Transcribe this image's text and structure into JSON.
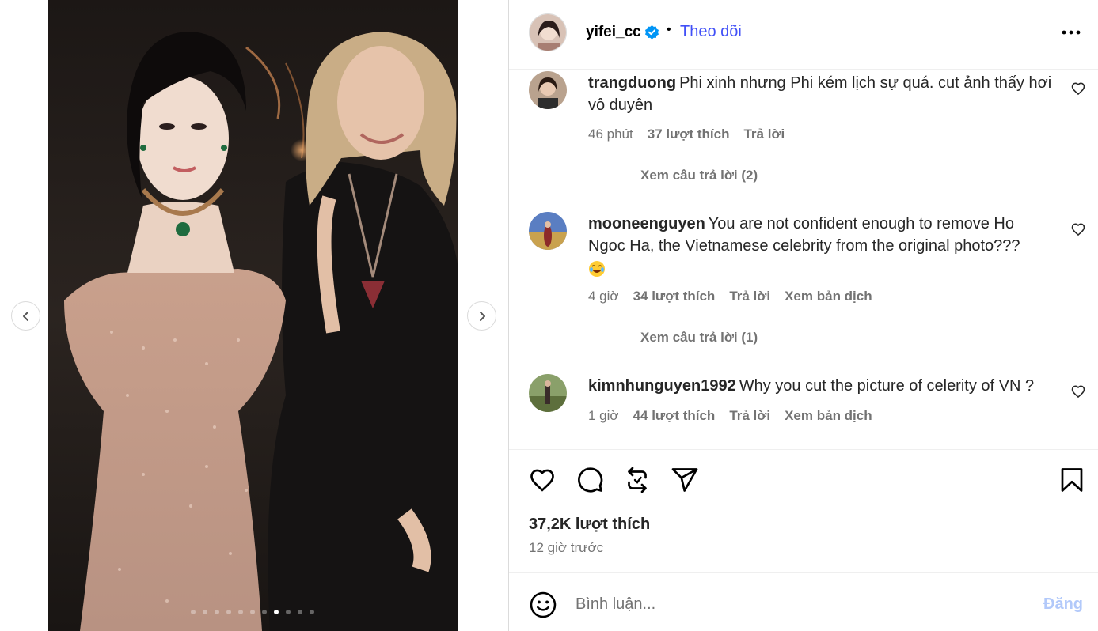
{
  "post": {
    "username": "yifei_cc",
    "separator": "•",
    "follow_label": "Theo dõi",
    "carousel": {
      "total": 11,
      "active_index": 7
    }
  },
  "comments": [
    {
      "username": "trangduong",
      "text": "Phi xinh nhưng Phi kém lịch sự quá. cut ảnh thấy hơi vô duyên",
      "time": "46 phút",
      "likes": "37 lượt thích",
      "reply": "Trả lời",
      "view_replies": "Xem câu trả lời (2)"
    },
    {
      "username": "mooneenguyen",
      "text": "You are not confident enough to remove Ho Ngoc Ha, the Vietnamese celebrity from the original photo???",
      "time": "4 giờ",
      "likes": "34 lượt thích",
      "reply": "Trả lời",
      "translate": "Xem bản dịch",
      "view_replies": "Xem câu trả lời (1)"
    },
    {
      "username": "kimnhunguyen1992",
      "text": "Why you cut the picture of celerity of VN ?",
      "time": "1 giờ",
      "likes": "44 lượt thích",
      "reply": "Trả lời",
      "translate": "Xem bản dịch"
    }
  ],
  "stats": {
    "likes": "37,2K lượt thích",
    "time": "12 giờ trước"
  },
  "composer": {
    "placeholder": "Bình luận...",
    "post_label": "Đăng"
  },
  "colors": {
    "accent": "#4150f7",
    "verified": "#0095f6",
    "muted": "#737373",
    "post_disabled": "#b2c9fa"
  },
  "icons": [
    "chevron-left-icon",
    "chevron-right-icon",
    "verified-badge-icon",
    "more-options-icon",
    "heart-icon",
    "comment-icon",
    "repost-icon",
    "share-icon",
    "save-icon",
    "emoji-icon"
  ]
}
